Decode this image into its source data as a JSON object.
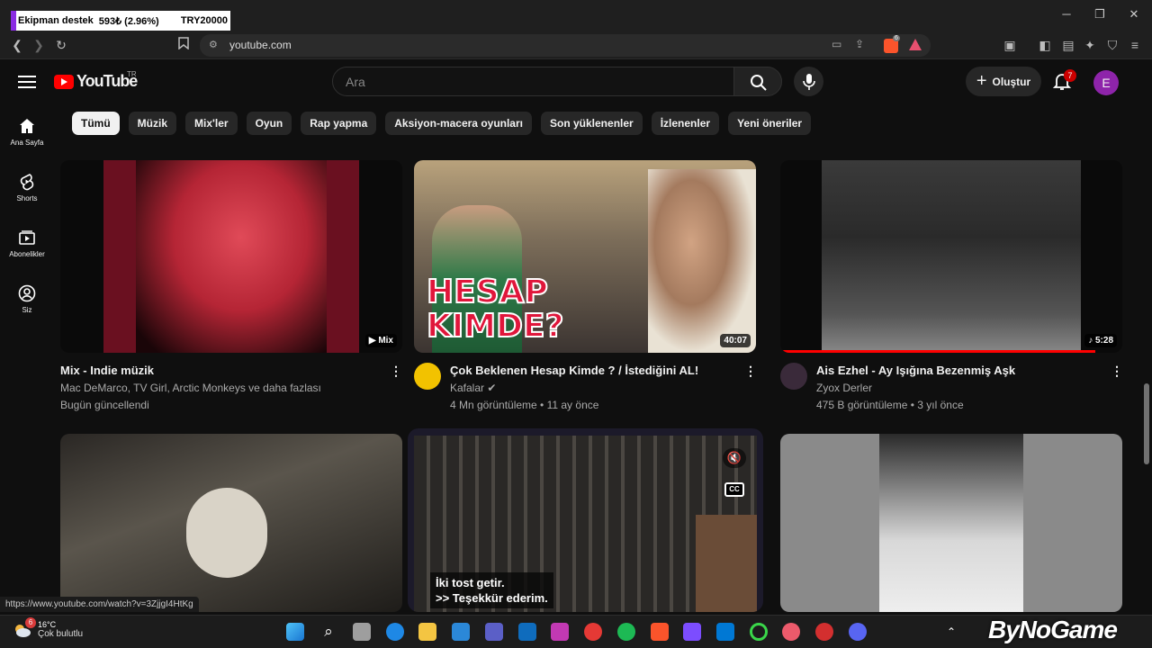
{
  "browser": {
    "tab": {
      "text1": "Ekipman destek",
      "text2": "593₺ (2.96%)",
      "text3": "TRY20000"
    },
    "window_controls": {
      "minimize": "─",
      "maximize": "❐",
      "close": "✕"
    },
    "url": "youtube.com",
    "extension_badge": "6"
  },
  "youtube": {
    "logo": "YouTube",
    "region": "TR",
    "search_placeholder": "Ara",
    "create_label": "Oluştur",
    "notifications_count": "7",
    "avatar_initial": "E",
    "sidebar": [
      {
        "label": "Ana Sayfa",
        "icon": "home-icon"
      },
      {
        "label": "Shorts",
        "icon": "shorts-icon"
      },
      {
        "label": "Abonelikler",
        "icon": "subscriptions-icon"
      },
      {
        "label": "Siz",
        "icon": "user-icon"
      }
    ],
    "chips": [
      "Tümü",
      "Müzik",
      "Mix'ler",
      "Oyun",
      "Rap yapma",
      "Aksiyon-macera oyunları",
      "Son yüklenenler",
      "İzlenenler",
      "Yeni öneriler"
    ],
    "videos": [
      {
        "title": "Mix - Indie müzik",
        "line1": "Mac DeMarco, TV Girl, Arctic Monkeys ve daha fazlası",
        "line2": "Bugün güncellendi",
        "badge": "Mix"
      },
      {
        "title": "Çok Beklenen Hesap Kimde ? / İstediğini AL!",
        "channel": "Kafalar",
        "stats": "4 Mn görüntüleme • 11 ay önce",
        "duration": "40:07",
        "thumb_text1": "HESAP",
        "thumb_text2": "KIMDE?"
      },
      {
        "title": "Ais Ezhel - Ay Işığına Bezenmiş Aşk",
        "channel": "Zyox Derler",
        "stats": "475 B görüntüleme • 3 yıl önce",
        "duration": "5:28"
      }
    ],
    "preview_subtitle": {
      "line1": "İki tost getir.",
      "line2": ">> Teşekkür ederim."
    }
  },
  "status_url": "https://www.youtube.com/watch?v=3ZjjgI4HtKg",
  "taskbar": {
    "temperature": "16°C",
    "weather": "Çok bulutlu",
    "weather_badge": "6"
  },
  "watermark": "ByNoGame"
}
